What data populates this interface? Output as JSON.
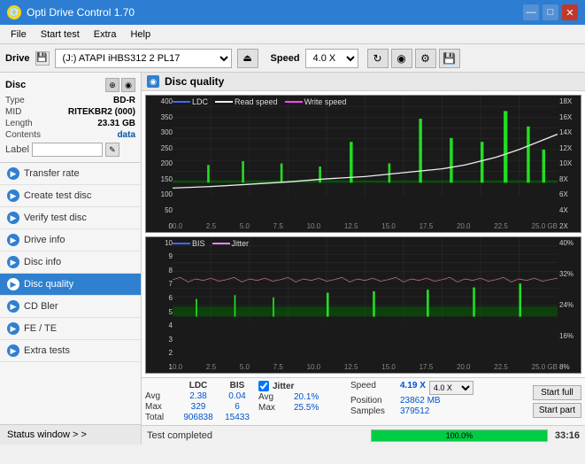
{
  "app": {
    "title": "Opti Drive Control 1.70",
    "icon": "💿"
  },
  "titlebar": {
    "minimize": "—",
    "maximize": "□",
    "close": "✕"
  },
  "menu": {
    "items": [
      "File",
      "Start test",
      "Extra",
      "Help"
    ]
  },
  "drive_bar": {
    "label": "Drive",
    "drive_value": "(J:) ATAPI iHBS312  2 PL17",
    "speed_label": "Speed",
    "speed_value": "4.0 X"
  },
  "disc": {
    "section_label": "Disc",
    "type_label": "Type",
    "type_value": "BD-R",
    "mid_label": "MID",
    "mid_value": "RITEKBR2 (000)",
    "length_label": "Length",
    "length_value": "23.31 GB",
    "contents_label": "Contents",
    "contents_value": "data",
    "label_label": "Label"
  },
  "nav": {
    "items": [
      {
        "id": "transfer-rate",
        "label": "Transfer rate"
      },
      {
        "id": "create-test-disc",
        "label": "Create test disc"
      },
      {
        "id": "verify-test-disc",
        "label": "Verify test disc"
      },
      {
        "id": "drive-info",
        "label": "Drive info"
      },
      {
        "id": "disc-info",
        "label": "Disc info"
      },
      {
        "id": "disc-quality",
        "label": "Disc quality",
        "active": true
      },
      {
        "id": "cd-bler",
        "label": "CD Bler"
      },
      {
        "id": "fe-te",
        "label": "FE / TE"
      },
      {
        "id": "extra-tests",
        "label": "Extra tests"
      }
    ],
    "status_window": "Status window > >"
  },
  "chart": {
    "title": "Disc quality",
    "top_legend": {
      "ldc_label": "LDC",
      "read_label": "Read speed",
      "write_label": "Write speed"
    },
    "bottom_legend": {
      "bis_label": "BIS",
      "jitter_label": "Jitter"
    },
    "top_y_left": [
      "400",
      "350",
      "300",
      "250",
      "200",
      "150",
      "100",
      "50",
      "0"
    ],
    "top_y_right": [
      "18X",
      "16X",
      "14X",
      "12X",
      "10X",
      "8X",
      "6X",
      "4X",
      "2X"
    ],
    "bottom_y_left": [
      "10",
      "9",
      "8",
      "7",
      "6",
      "5",
      "4",
      "3",
      "2",
      "1"
    ],
    "bottom_y_right": [
      "40%",
      "32%",
      "24%",
      "16%",
      "8%"
    ],
    "x_labels": [
      "0.0",
      "2.5",
      "5.0",
      "7.5",
      "10.0",
      "12.5",
      "15.0",
      "17.5",
      "20.0",
      "22.5",
      "25.0 GB"
    ]
  },
  "stats": {
    "headers": [
      "",
      "LDC",
      "BIS"
    ],
    "avg_label": "Avg",
    "avg_ldc": "2.38",
    "avg_bis": "0.04",
    "max_label": "Max",
    "max_ldc": "329",
    "max_bis": "6",
    "total_label": "Total",
    "total_ldc": "906838",
    "total_bis": "15433",
    "jitter_label": "Jitter",
    "avg_jitter": "20.1%",
    "max_jitter": "25.5%",
    "speed_label": "Speed",
    "speed_value": "4.19 X",
    "speed_select": "4.0 X",
    "position_label": "Position",
    "position_value": "23862 MB",
    "samples_label": "Samples",
    "samples_value": "379512",
    "start_full": "Start full",
    "start_part": "Start part"
  },
  "bottom": {
    "status": "Test completed",
    "progress": "100.0%",
    "progress_pct": 100,
    "time": "33:16"
  }
}
